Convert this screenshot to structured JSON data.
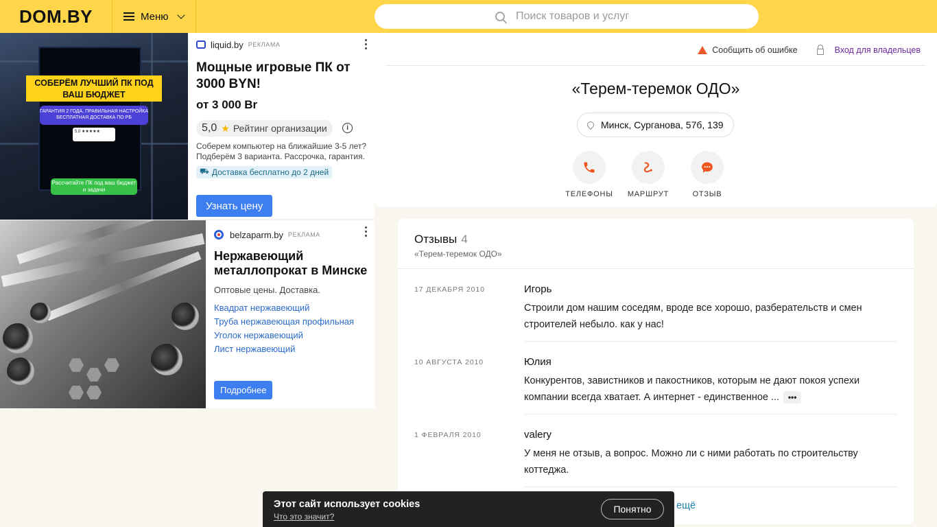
{
  "header": {
    "logo": "DOM.BY",
    "menu_label": "Меню",
    "search_placeholder": "Поиск товаров и услуг"
  },
  "ad1": {
    "image_texts": {
      "headline": "СОБЕРЁМ ЛУЧШИЙ ПК ПОД ВАШ БЮДЖЕТ",
      "sub": "ГАРАНТИЯ 2 ГОДА, ПРАВИЛЬНАЯ НАСТРОЙКА БЕСПЛАТНАЯ ДОСТАВКА ПО РБ",
      "rating": "5,0 ★★★★★",
      "cta": "Рассчитайте ПК под ваш бюджет и задачи"
    },
    "source": "liquid.by",
    "ad_tag": "РЕКЛАМА",
    "title": "Мощные игровые ПК от 3000 BYN!",
    "price": "от 3 000 Br",
    "rating_value": "5,0",
    "rating_label": "Рейтинг организации",
    "info_label": "i",
    "description": "Соберем компьютер на ближайшие 3-5 лет? Подберём 3 варианта. Рассрочка, гарантия.",
    "delivery": "Доставка бесплатно до 2 дней",
    "button": "Узнать цену"
  },
  "ad2": {
    "source": "belzaparm.by",
    "ad_tag": "РЕКЛАМА",
    "title": "Нержавеющий металлопрокат в Минске",
    "description": "Оптовые цены. Доставка.",
    "links": [
      "Квадрат нержавеющий",
      "Труба нержавеющая профильная",
      "Уголок нержавеющий",
      "Лист нержавеющий"
    ],
    "button": "Подробнее"
  },
  "company": {
    "report_label": "Сообщить об ошибке",
    "owners_label": "Вход для владельцев",
    "name": "«Терем-теремок ОДО»",
    "address": "Минск, Сурганова, 57б, 139",
    "actions": [
      {
        "label": "ТЕЛЕФОНЫ",
        "icon": "phone-icon"
      },
      {
        "label": "МАРШРУТ",
        "icon": "route-icon"
      },
      {
        "label": "ОТЗЫВ",
        "icon": "review-chat-icon"
      }
    ]
  },
  "reviews": {
    "title": "Отзывы",
    "count": "4",
    "subtitle": "«Терем-теремок ОДО»",
    "items": [
      {
        "date": "17 ДЕКАБРЯ 2010",
        "author": "Игорь",
        "text": "Строили дом нашим соседям, вроде все хорошо, разберательств и смен строителей небыло. как у нас!"
      },
      {
        "date": "10 АВГУСТА 2010",
        "author": "Юлия",
        "text": "Конкурентов, завистников и пакостников, которым не дают покоя успехи компании всегда хватает. А интернет - единственное ..."
      },
      {
        "date": "1 ФЕВРАЛЯ 2010",
        "author": "valery",
        "text": "У меня не отзыв, а вопрос. Можно ли с ними работать по строительству коттеджа."
      }
    ],
    "more_label": "•••",
    "all_reviews_label": "ещё"
  },
  "cookie": {
    "title": "Этот сайт использует cookies",
    "link": "Что это значит?",
    "button": "Понятно"
  },
  "colors": {
    "header_bg": "#ffd54a",
    "accent_orange": "#f0541e",
    "link_blue": "#2a6ac8",
    "button_blue": "#3d7ff0",
    "owners_purple": "#6a2a9e"
  }
}
